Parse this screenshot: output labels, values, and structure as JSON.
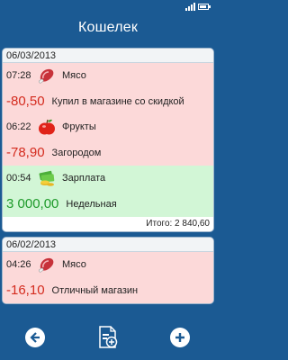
{
  "app": {
    "title": "Кошелек"
  },
  "days": [
    {
      "date": "06/03/2013",
      "entries": [
        {
          "type": "expense",
          "time": "07:28",
          "icon": "meat-icon",
          "category": "Мясо",
          "amount": "-80,50",
          "note": "Купил в магазине со скидкой"
        },
        {
          "type": "expense",
          "time": "06:22",
          "icon": "apple-icon",
          "category": "Фрукты",
          "amount": "-78,90",
          "note": "Загородом"
        },
        {
          "type": "income",
          "time": "00:54",
          "icon": "money-icon",
          "category": "Зарплата",
          "amount": "3 000,00",
          "note": "Недельная"
        }
      ],
      "total": "Итого: 2 840,60"
    },
    {
      "date": "06/02/2013",
      "entries": [
        {
          "type": "expense",
          "time": "04:26",
          "icon": "meat-icon",
          "category": "Мясо",
          "amount": "-16,10",
          "note": "Отличный магазин"
        }
      ]
    }
  ],
  "app_bar": {
    "buttons": [
      "back-icon",
      "report-icon",
      "add-icon"
    ]
  },
  "colors": {
    "background": "#1B5A93",
    "expense_row": "#FCD9D9",
    "income_row": "#D2F6D6",
    "negative_amount": "#D42B1E",
    "positive_amount": "#1E9A2A"
  }
}
